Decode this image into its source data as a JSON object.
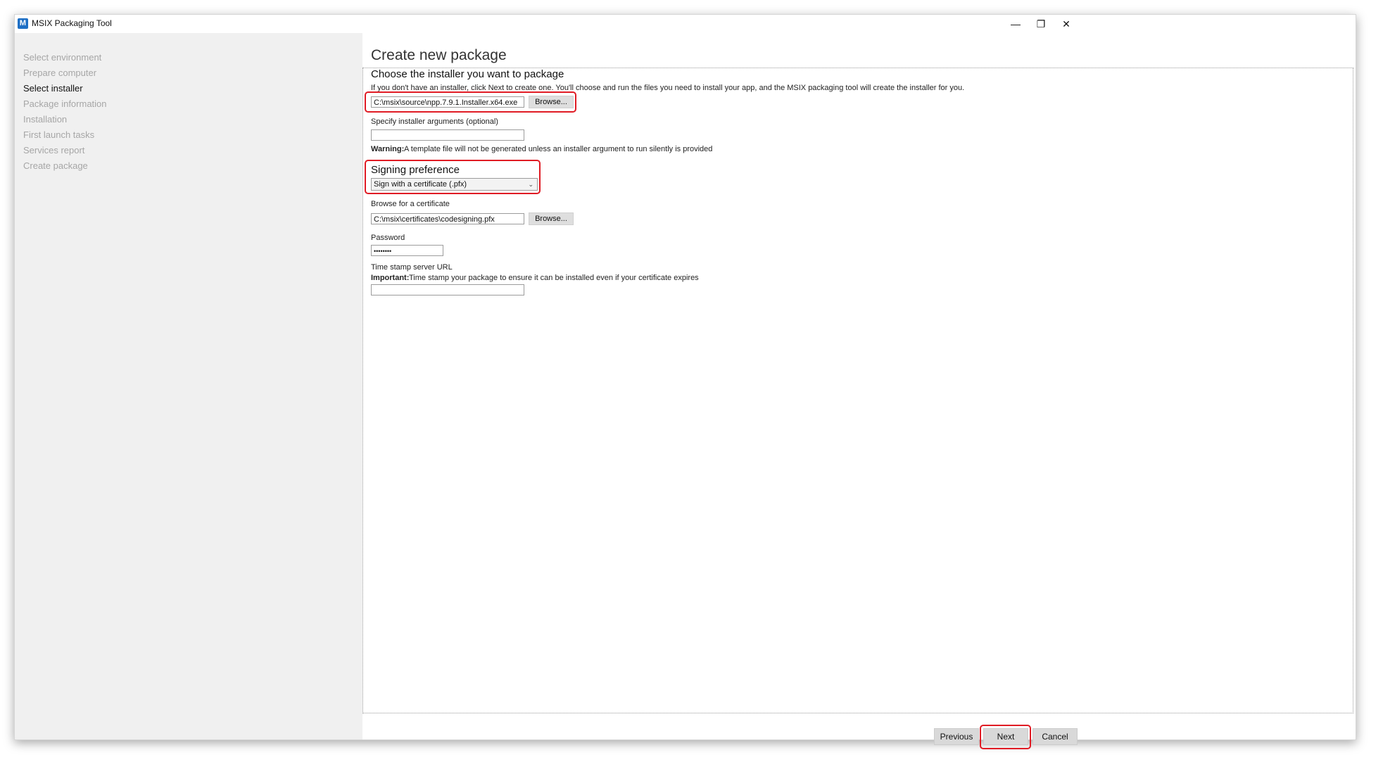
{
  "window": {
    "title": "MSIX Packaging Tool",
    "app_icon_glyph": "M",
    "controls": {
      "minimize": "—",
      "restore": "❐",
      "close": "✕"
    }
  },
  "sidebar": {
    "items": [
      {
        "label": "Select environment",
        "active": false
      },
      {
        "label": "Prepare computer",
        "active": false
      },
      {
        "label": "Select installer",
        "active": true
      },
      {
        "label": "Package information",
        "active": false
      },
      {
        "label": "Installation",
        "active": false
      },
      {
        "label": "First launch tasks",
        "active": false
      },
      {
        "label": "Services report",
        "active": false
      },
      {
        "label": "Create package",
        "active": false
      }
    ]
  },
  "main": {
    "title": "Create new package",
    "installer": {
      "heading": "Choose the installer you want to package",
      "description": "If you don't have an installer, click Next to create one. You'll choose and run the files you need to install your app, and the MSIX packaging tool will create the installer for you.",
      "path_value": "C:\\msix\\source\\npp.7.9.1.Installer.x64.exe",
      "browse_label": "Browse..."
    },
    "arguments": {
      "label": "Specify installer arguments (optional)",
      "value": "",
      "warning_label": "Warning:",
      "warning_text": "A template file will not be generated unless an installer argument to run silently is provided"
    },
    "signing": {
      "heading": "Signing preference",
      "selected": "Sign with a certificate (.pfx)"
    },
    "certificate": {
      "label": "Browse for a certificate",
      "path_value": "C:\\msix\\certificates\\codesigning.pfx",
      "browse_label": "Browse..."
    },
    "password": {
      "label": "Password",
      "value": "••••••••"
    },
    "timestamp": {
      "label": "Time stamp server URL",
      "important_label": "Important:",
      "important_text": "Time stamp your package to ensure it can be installed even if your certificate expires",
      "value": ""
    }
  },
  "footer": {
    "previous_label": "Previous",
    "next_label": "Next",
    "cancel_label": "Cancel"
  },
  "colors": {
    "highlight": "#e01b24",
    "sidebar_bg": "#f0f0f0",
    "app_icon": "#1e6fc5"
  }
}
